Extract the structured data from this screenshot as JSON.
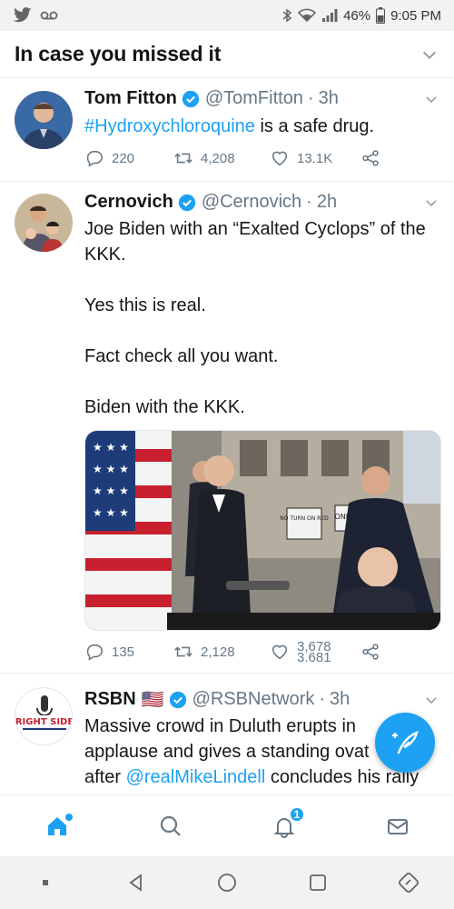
{
  "status_bar": {
    "battery": "46%",
    "time": "9:05 PM"
  },
  "header": {
    "title": "In case you missed it"
  },
  "tweets": [
    {
      "name": "Tom Fitton",
      "handle": "@TomFitton",
      "time": "3h",
      "hashtag": "#Hydroxychloroquine",
      "text_rest": " is a safe drug.",
      "replies": "220",
      "retweets": "4,208",
      "likes": "13.1K"
    },
    {
      "name": "Cernovich",
      "handle": "@Cernovich",
      "time": "2h",
      "paragraphs": [
        "Joe Biden with an “Exalted Cyclops” of the KKK.",
        "Yes this is real.",
        "Fact check all you want.",
        "Biden with the KKK."
      ],
      "sign_no_turn": "NO TURN ON RED",
      "sign_one_way": "ONE WAY",
      "replies": "135",
      "retweets": "2,128",
      "likes_top": "3,678",
      "likes_bottom": "3,681"
    },
    {
      "name": "RSBN",
      "flag": "🇺🇸",
      "handle": "@RSBNetwork",
      "time": "3h",
      "avatar_text": "RIGHT SIDE",
      "text_line1": "Massive crowd in Duluth erupts in",
      "text_line2": "applause and gives a standing ovat",
      "text_line3_pre": "after ",
      "mention": "@realMikeLindell",
      "text_line3_post": " concludes his rally"
    }
  ],
  "tabbar": {
    "notification_badge": "1"
  },
  "colors": {
    "accent": "#1da1f2",
    "muted": "#657786"
  }
}
